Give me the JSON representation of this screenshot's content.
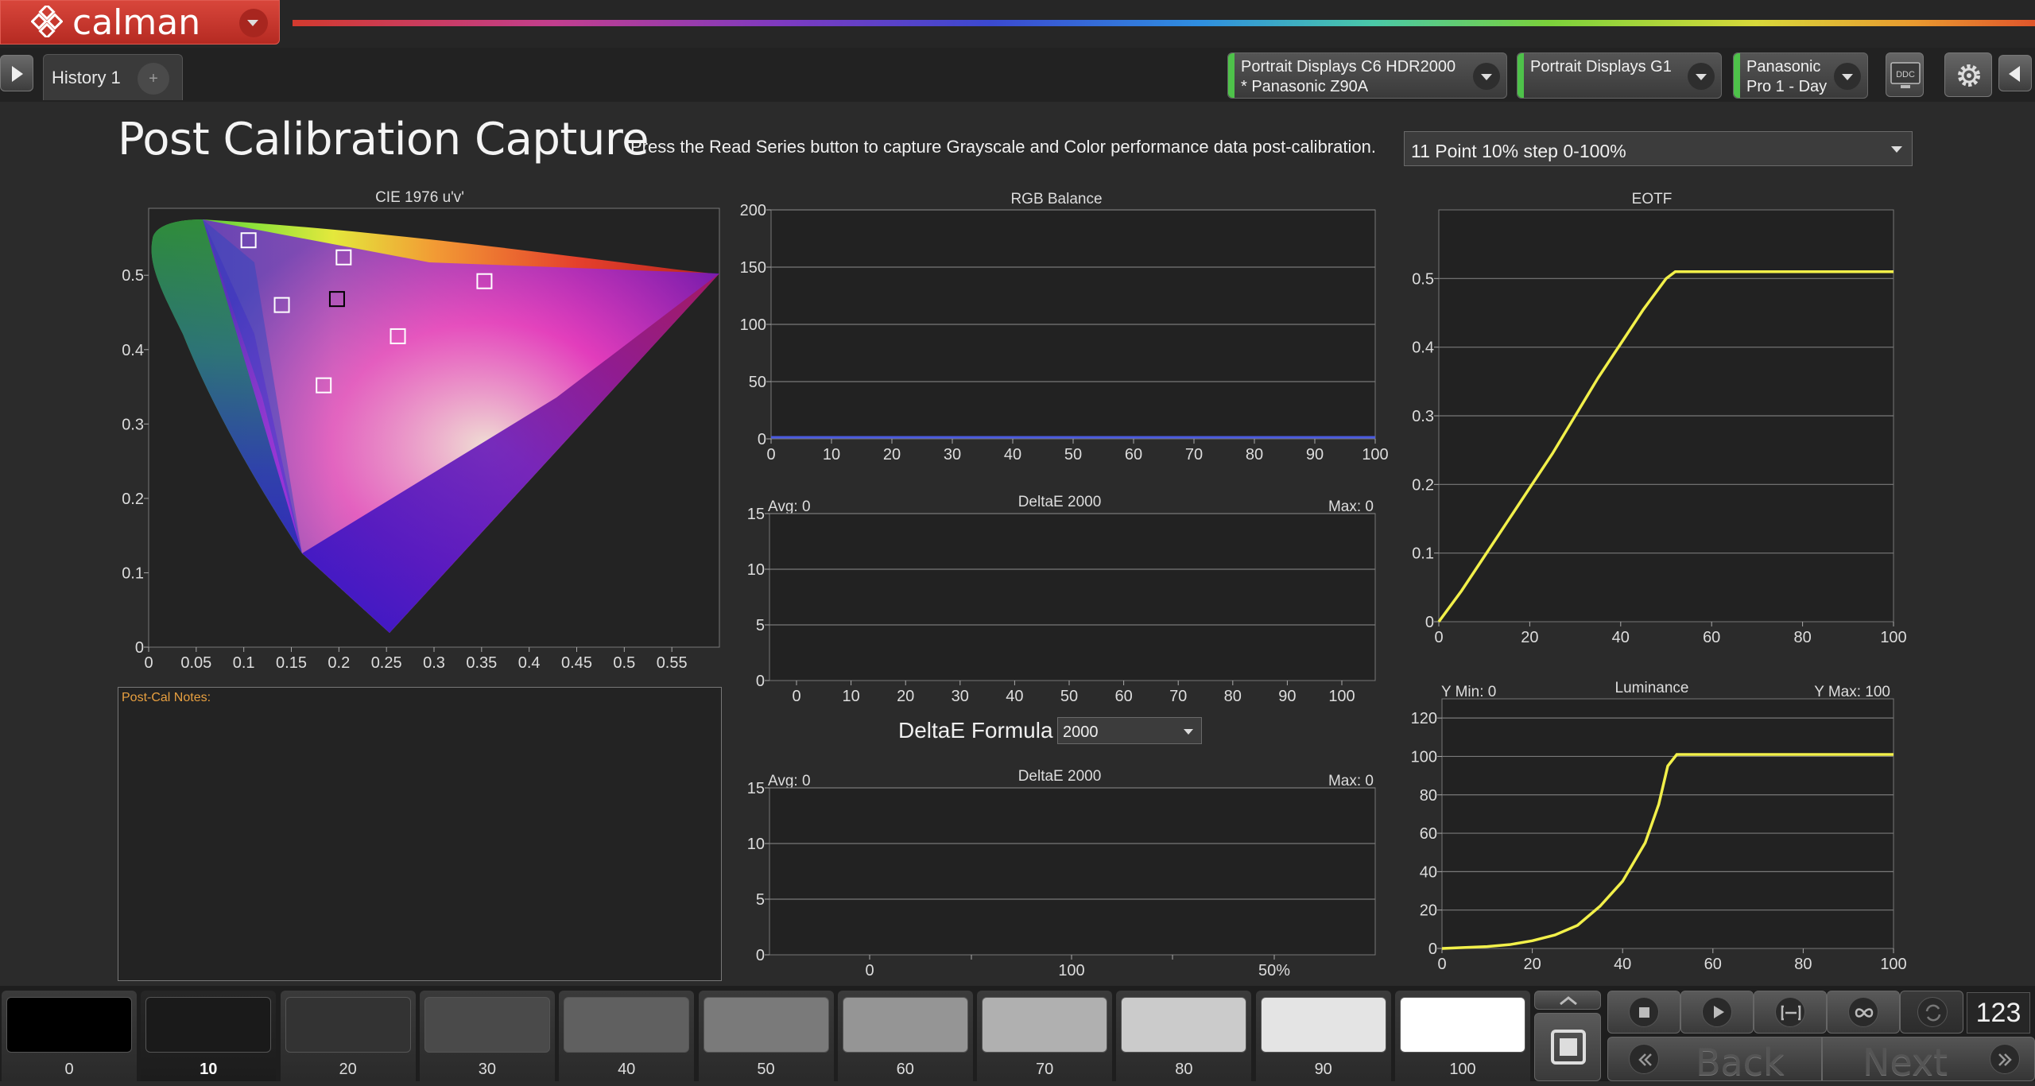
{
  "app": {
    "name": "calman"
  },
  "tabs": [
    {
      "label": "History 1"
    }
  ],
  "devices": [
    {
      "line1": "Portrait Displays C6 HDR2000",
      "line2": "* Panasonic Z90A",
      "status_color": "#4ec24a"
    },
    {
      "line1": "Portrait Displays G1",
      "line2": "",
      "status_color": "#4ec24a"
    },
    {
      "line1": "Panasonic",
      "line2": "Pro 1 - Day",
      "status_color": "#4ec24a"
    }
  ],
  "toolbar": {
    "ddc_label": "DDC"
  },
  "page": {
    "title": "Post Calibration Capture",
    "instruction": "Press the Read Series button to capture Grayscale and Color performance data post-calibration.",
    "series_select": "11 Point 10% step 0-100%"
  },
  "notes": {
    "label": "Post-Cal Notes:"
  },
  "deltae_formula": {
    "label": "DeltaE Formula",
    "value": "2000"
  },
  "chart_data": [
    {
      "id": "cie",
      "type": "scatter",
      "title": "CIE 1976 u'v'",
      "xticks": [
        "0",
        "0.05",
        "0.1",
        "0.15",
        "0.2",
        "0.25",
        "0.3",
        "0.35",
        "0.4",
        "0.45",
        "0.5",
        "0.55"
      ],
      "yticks": [
        "0",
        "0.1",
        "0.2",
        "0.3",
        "0.4",
        "0.5"
      ],
      "xlim": [
        0,
        0.6
      ],
      "ylim": [
        0,
        0.59
      ],
      "points": [
        {
          "u": 0.105,
          "v": 0.547,
          "color": "#ffffff"
        },
        {
          "u": 0.205,
          "v": 0.524,
          "color": "#ffffff"
        },
        {
          "u": 0.14,
          "v": 0.46,
          "color": "#ffffff"
        },
        {
          "u": 0.198,
          "v": 0.468,
          "color": "#000000"
        },
        {
          "u": 0.353,
          "v": 0.492,
          "color": "#ffffff"
        },
        {
          "u": 0.262,
          "v": 0.418,
          "color": "#ffffff"
        },
        {
          "u": 0.184,
          "v": 0.352,
          "color": "#ffffff"
        }
      ]
    },
    {
      "id": "rgb",
      "type": "line",
      "title": "RGB Balance",
      "xticks": [
        "0",
        "10",
        "20",
        "30",
        "40",
        "50",
        "60",
        "70",
        "80",
        "90",
        "100"
      ],
      "yticks": [
        "0",
        "50",
        "100",
        "150",
        "200"
      ],
      "xlim": [
        0,
        100
      ],
      "ylim": [
        0,
        200
      ],
      "series": [
        {
          "x": [
            0,
            100
          ],
          "y": [
            0,
            0
          ],
          "color": "#4a5ae0"
        }
      ]
    },
    {
      "id": "de1",
      "type": "bar",
      "title": "DeltaE 2000",
      "avg": "Avg: 0",
      "max": "Max: 0",
      "xticks": [
        "0",
        "10",
        "20",
        "30",
        "40",
        "50",
        "60",
        "70",
        "80",
        "90",
        "100"
      ],
      "yticks": [
        "0",
        "5",
        "10",
        "15"
      ],
      "ylim": [
        0,
        15
      ],
      "values": []
    },
    {
      "id": "de2",
      "type": "bar",
      "title": "DeltaE 2000",
      "avg": "Avg: 0",
      "max": "Max: 0",
      "xticks": [
        "0",
        "100",
        "50%"
      ],
      "yticks": [
        "0",
        "5",
        "10",
        "15"
      ],
      "ylim": [
        0,
        15
      ],
      "values": []
    },
    {
      "id": "eotf",
      "type": "line",
      "title": "EOTF",
      "xticks": [
        "0",
        "20",
        "40",
        "60",
        "80",
        "100"
      ],
      "yticks": [
        "0",
        "0.1",
        "0.2",
        "0.3",
        "0.4",
        "0.5"
      ],
      "xlim": [
        0,
        100
      ],
      "ylim": [
        0,
        0.6
      ],
      "series": [
        {
          "x": [
            0,
            5,
            10,
            15,
            20,
            25,
            30,
            35,
            40,
            45,
            50,
            52,
            60,
            70,
            80,
            90,
            100
          ],
          "y": [
            0,
            0.045,
            0.095,
            0.145,
            0.195,
            0.245,
            0.3,
            0.355,
            0.405,
            0.455,
            0.5,
            0.51,
            0.51,
            0.51,
            0.51,
            0.51,
            0.51
          ],
          "color": "#f2f04a"
        }
      ]
    },
    {
      "id": "lum",
      "type": "line",
      "title": "Luminance",
      "ymin_label": "Y Min: 0",
      "ymax_label": "Y Max: 100",
      "xticks": [
        "0",
        "20",
        "40",
        "60",
        "80",
        "100"
      ],
      "yticks": [
        "0",
        "20",
        "40",
        "60",
        "80",
        "100",
        "120"
      ],
      "xlim": [
        0,
        100
      ],
      "ylim": [
        0,
        130
      ],
      "series": [
        {
          "x": [
            0,
            10,
            15,
            20,
            25,
            30,
            35,
            40,
            45,
            48,
            50,
            52,
            60,
            70,
            80,
            90,
            100
          ],
          "y": [
            0,
            1,
            2,
            4,
            7,
            12,
            22,
            35,
            55,
            75,
            95,
            101,
            101,
            101,
            101,
            101,
            101
          ],
          "color": "#f2f04a"
        }
      ]
    }
  ],
  "swatches": [
    {
      "label": "0",
      "color": "#000000"
    },
    {
      "label": "10",
      "color": "#1a1a1a"
    },
    {
      "label": "20",
      "color": "#333333"
    },
    {
      "label": "30",
      "color": "#4a4a4a"
    },
    {
      "label": "40",
      "color": "#606060"
    },
    {
      "label": "50",
      "color": "#7a7a7a"
    },
    {
      "label": "60",
      "color": "#959595"
    },
    {
      "label": "70",
      "color": "#b0b0b0"
    },
    {
      "label": "80",
      "color": "#cbcbcb"
    },
    {
      "label": "90",
      "color": "#e4e4e4"
    },
    {
      "label": "100",
      "color": "#ffffff"
    }
  ],
  "selected_swatch": "10",
  "nav": {
    "back": "Back",
    "next": "Next",
    "counter": "123"
  }
}
